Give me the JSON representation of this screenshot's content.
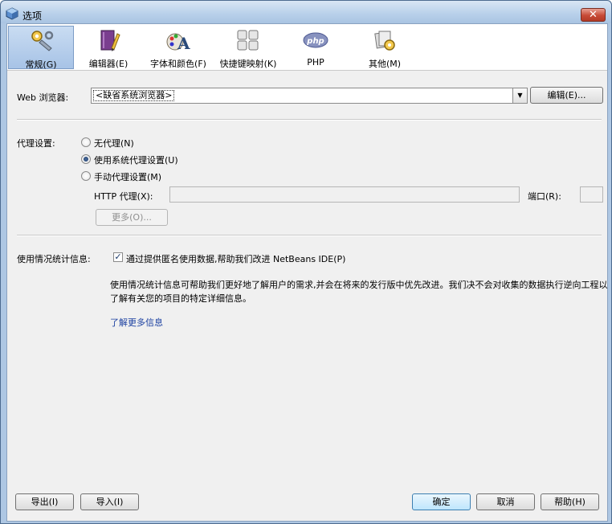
{
  "window": {
    "title": "选项",
    "close_glyph": "✕"
  },
  "tabs": [
    {
      "label": "常规(G)",
      "icon": "wrench-gear-icon",
      "active": true
    },
    {
      "label": "编辑器(E)",
      "icon": "pencil-book-icon",
      "active": false
    },
    {
      "label": "字体和颜色(F)",
      "icon": "font-palette-icon",
      "active": false
    },
    {
      "label": "快捷键映射(K)",
      "icon": "keyboard-icon",
      "active": false
    },
    {
      "label": "PHP",
      "icon": "php-icon",
      "active": false
    },
    {
      "label": "其他(M)",
      "icon": "misc-gear-icon",
      "active": false
    }
  ],
  "browser": {
    "label": "Web 浏览器:",
    "selected": "<缺省系统浏览器>",
    "edit_button": "编辑(E)..."
  },
  "proxy": {
    "label": "代理设置:",
    "options": [
      {
        "label": "无代理(N)",
        "selected": false
      },
      {
        "label": "使用系统代理设置(U)",
        "selected": true
      },
      {
        "label": "手动代理设置(M)",
        "selected": false
      }
    ],
    "http_label": "HTTP 代理(X):",
    "http_value": "",
    "port_label": "端口(R):",
    "port_value": "",
    "more_button": "更多(O)..."
  },
  "usage": {
    "label": "使用情况统计信息:",
    "checkbox_label": "通过提供匿名使用数据,帮助我们改进 NetBeans IDE(P)",
    "checked": true,
    "description": "使用情况统计信息可帮助我们更好地了解用户的需求,并会在将来的发行版中优先改进。我们决不会对收集的数据执行逆向工程以了解有关您的项目的特定详细信息。",
    "learn_more": "了解更多信息"
  },
  "footer": {
    "export": "导出(I)",
    "import": "导入(I)",
    "ok": "确定",
    "cancel": "取消",
    "help": "帮助(H)"
  }
}
